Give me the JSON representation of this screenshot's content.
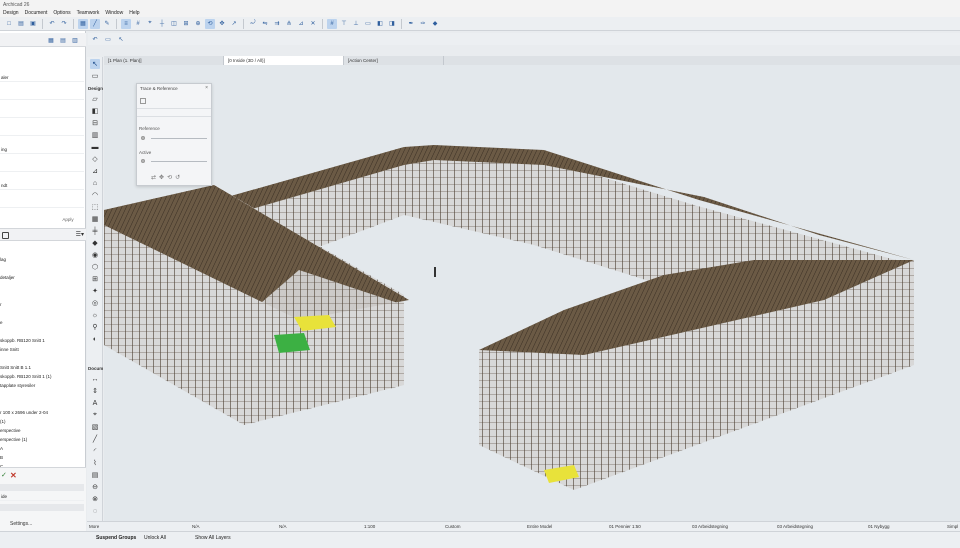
{
  "app": {
    "title": "Archicad 26",
    "menu": [
      "Design",
      "Document",
      "Options",
      "Teamwork",
      "Window",
      "Help"
    ]
  },
  "toolbar": {
    "icons": [
      "new-icon",
      "open-icon",
      "save-icon",
      "print-icon",
      "undo-icon",
      "redo-icon",
      "select-icon",
      "arrow-icon",
      "magic-wand-icon",
      "layers-icon",
      "grid-icon",
      "snap-icon",
      "guide-icon",
      "trace-icon",
      "measure-icon",
      "zoom-icon",
      "pan-icon",
      "orbit-icon",
      "settings-icon"
    ]
  },
  "tabs": [
    {
      "label": "[1 Plan (1. Plan)]",
      "active": false
    },
    {
      "label": "[0 Inside (3D / All)]",
      "active": true
    },
    {
      "label": "[Action Center]",
      "active": false
    }
  ],
  "left_panel": {
    "rows": [
      "aler",
      "",
      "ing",
      "",
      "ndt",
      "",
      "",
      ""
    ],
    "apply_label": "Apply",
    "tree": [
      "lag",
      "detaljer",
      "",
      "",
      "r",
      "",
      "e",
      "",
      "skoppb. RB120 Snitt 1",
      "inne Snitt",
      "",
      "Snitt Snitt B 1.1",
      "skoppb. RB120 Snitt 1 (1)",
      "tapplate styresiler",
      "",
      "r 100 x 2696 under 2-04",
      "(1)",
      "erspective",
      "erspective (1)",
      "A",
      "B",
      "C"
    ],
    "bottom_label": "ide",
    "settings_label": "Settings..."
  },
  "toolbox": {
    "sections": [
      "Design",
      "Docum"
    ]
  },
  "trace_palette": {
    "title": "Trace & Reference",
    "reference_label": "Reference",
    "active_label": "Active"
  },
  "status_bar": {
    "more_label": "More",
    "values": [
      "N/A",
      "N/A",
      "1:100",
      "Custom",
      "Entire Model",
      "01 Pennier 1:50",
      "03 Arbeidstegning",
      "03 Arbeidstegning",
      "01 Nybygg",
      "Simpl"
    ]
  },
  "bottom_bar": {
    "suspend_groups": "Suspend Groups",
    "unlock_all": "Unlock All",
    "show_all_layers": "Show All Layers"
  },
  "colors": {
    "frame": "#4a3c2e",
    "roof": "#6b5a45",
    "highlight_yellow": "#e8e23a",
    "highlight_green": "#3cb043"
  }
}
